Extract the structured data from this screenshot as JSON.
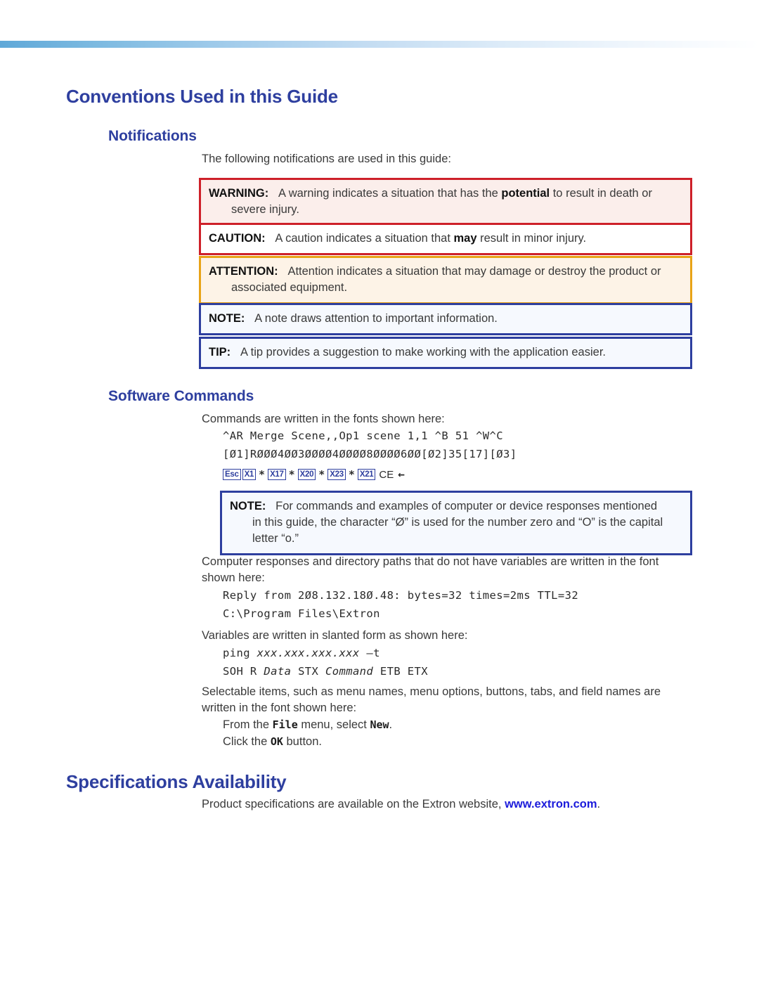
{
  "page": {
    "headings": {
      "conventions": "Conventions Used in this Guide",
      "notifications": "Notifications",
      "software_commands": "Software Commands",
      "specifications": "Specifications Availability"
    },
    "intro_notifications": "The following notifications are used in this guide:",
    "notices": [
      {
        "id": "warning",
        "label": "WARNING:",
        "line1_a": "A warning indicates a situation that has the ",
        "line1_bold": "potential",
        "line1_b": " to result in death or",
        "line2": "severe injury.",
        "border_color": "#ce2029",
        "background_color": "#fbeeeb"
      },
      {
        "id": "caution",
        "label": "CAUTION:",
        "line1_a": "A caution indicates a situation that ",
        "line1_bold": "may",
        "line1_b": " result in minor injury.",
        "line2": "",
        "border_color": "#ce2029",
        "background_color": "#ffffff"
      },
      {
        "id": "attention",
        "label": "ATTENTION:",
        "line1_a": "Attention indicates a situation that may damage or destroy the product or",
        "line1_bold": "",
        "line1_b": "",
        "line2": "associated equipment.",
        "border_color": "#e8a317",
        "background_color": "#fdf3e7"
      },
      {
        "id": "note",
        "label": "NOTE:",
        "line1_a": "A note draws attention to important information.",
        "line1_bold": "",
        "line1_b": "",
        "line2": "",
        "border_color": "#2e3f9f",
        "background_color": "#f6f9fe"
      },
      {
        "id": "tip",
        "label": "TIP:",
        "line1_a": "A tip provides a suggestion to make working with the application easier.",
        "line1_bold": "",
        "line1_b": "",
        "line2": "",
        "border_color": "#2e3f9f",
        "background_color": "#f6f9fe"
      }
    ],
    "software": {
      "intro": "Commands are written in the fonts shown here:",
      "code_line_1": "^AR Merge Scene,,Op1 scene 1,1 ^B 51 ^W^C",
      "code_line_2": "[Ø1]RØØØ4ØØ3ØØØØ4ØØØØ8ØØØØ6ØØ[Ø2]35[17][Ø3]",
      "keycaps": [
        "Esc",
        "X1",
        "X17",
        "X20",
        "X23",
        "X21"
      ],
      "keycap_separator": "*",
      "keycap_suffix": "CE",
      "keycap_arrow": "←",
      "note": {
        "label": "NOTE:",
        "line1": "For commands and examples of computer or device responses mentioned",
        "line2": "in this guide, the character “Ø” is used for the number zero and “O” is the capital",
        "line3": "letter “o.”"
      },
      "responses_intro_l1": "Computer responses and directory paths that do not have variables are written in the font",
      "responses_intro_l2": "shown here:",
      "response_line_1": "Reply from 2Ø8.132.18Ø.48: bytes=32 times=2ms TTL=32",
      "response_line_2": "C:\\Program Files\\Extron",
      "variables_intro": "Variables are written in slanted form as shown here:",
      "variable_line_1_a": "ping ",
      "variable_line_1_italic": "xxx.xxx.xxx.xxx",
      "variable_line_1_b": " –t",
      "variable_line_2_a": "SOH R ",
      "variable_line_2_italic1": "Data",
      "variable_line_2_b": " STX ",
      "variable_line_2_italic2": "Command",
      "variable_line_2_c": " ETB ETX",
      "selectable_intro_l1": "Selectable items, such as menu names, menu options, buttons, tabs, and field names are",
      "selectable_intro_l2": "written in the font shown here:",
      "selectable_1_a": "From the ",
      "selectable_1_mono1": "File",
      "selectable_1_b": " menu, select ",
      "selectable_1_mono2": "New",
      "selectable_1_c": ".",
      "selectable_2_a": "Click the ",
      "selectable_2_mono": "OK",
      "selectable_2_b": " button."
    },
    "specifications": {
      "text_a": "Product specifications are available on the Extron website, ",
      "link": "www.extron.com",
      "text_b": "."
    },
    "colors": {
      "heading_blue": "#2e3f9f",
      "link_blue": "#1c1cdb",
      "red": "#ce2029",
      "orange": "#e8a317",
      "body": "#3a3a3a"
    }
  }
}
